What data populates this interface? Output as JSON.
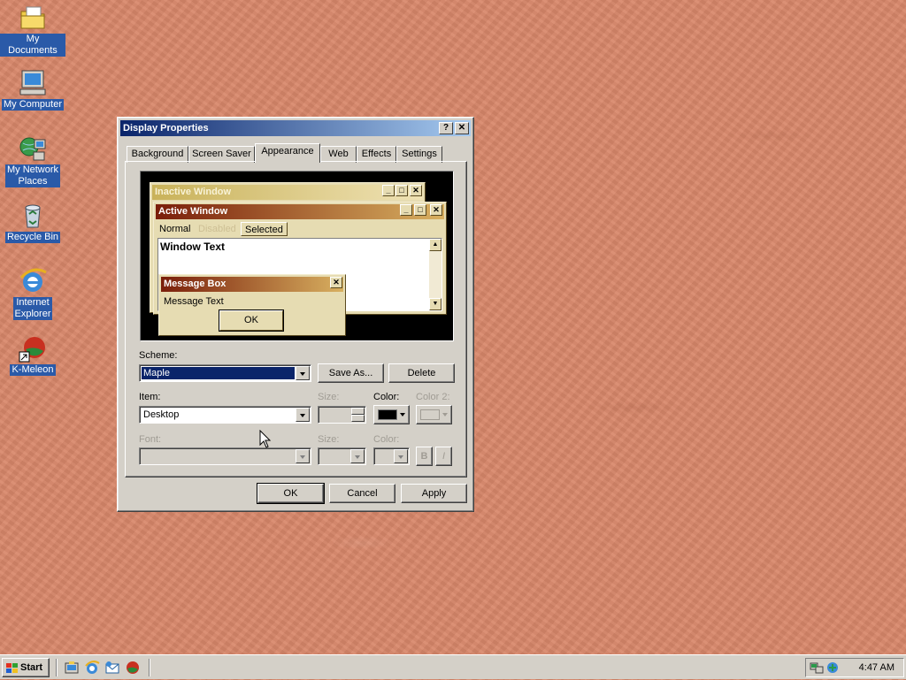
{
  "desktop": {
    "icons": [
      {
        "label": "My Documents",
        "icon": "my-documents-icon"
      },
      {
        "label": "My Computer",
        "icon": "my-computer-icon"
      },
      {
        "label_line1": "My Network",
        "label_line2": "Places",
        "icon": "network-places-icon"
      },
      {
        "label": "Recycle Bin",
        "icon": "recycle-bin-icon"
      },
      {
        "label_line1": "Internet",
        "label_line2": "Explorer",
        "icon": "internet-explorer-icon"
      },
      {
        "label": "K-Meleon",
        "icon": "k-meleon-icon"
      }
    ]
  },
  "dialog": {
    "title": "Display Properties",
    "help_button": "?",
    "close_button": "✕",
    "tabs": [
      {
        "label": "Background"
      },
      {
        "label": "Screen Saver"
      },
      {
        "label": "Appearance",
        "active": true
      },
      {
        "label": "Web"
      },
      {
        "label": "Effects"
      },
      {
        "label": "Settings"
      }
    ],
    "preview": {
      "inactive_title": "Inactive Window",
      "active_title": "Active Window",
      "menu": {
        "normal": "Normal",
        "disabled": "Disabled",
        "selected": "Selected"
      },
      "window_text": "Window Text",
      "message_box_title": "Message Box",
      "message_text": "Message Text",
      "ok": "OK"
    },
    "scheme": {
      "label": "Scheme:",
      "value": "Maple",
      "save_as": "Save As...",
      "delete": "Delete"
    },
    "item": {
      "label": "Item:",
      "value": "Desktop",
      "size_label": "Size:",
      "color_label": "Color:",
      "color2_label": "Color 2:",
      "color_value": "#000000"
    },
    "font": {
      "label": "Font:",
      "size_label": "Size:",
      "color_label": "Color:",
      "bold": "B",
      "italic": "I"
    },
    "buttons": {
      "ok": "OK",
      "cancel": "Cancel",
      "apply": "Apply"
    }
  },
  "taskbar": {
    "start": "Start",
    "quick_launch": [
      "show-desktop-icon",
      "internet-explorer-icon",
      "outlook-express-icon",
      "k-meleon-icon"
    ],
    "clock": "4:47 AM"
  },
  "colors": {
    "desktop_bg": "#d9876a",
    "active_title_start": "#0a246a",
    "scheme_title": "#7a1e0a",
    "face": "#d4d0c8"
  }
}
